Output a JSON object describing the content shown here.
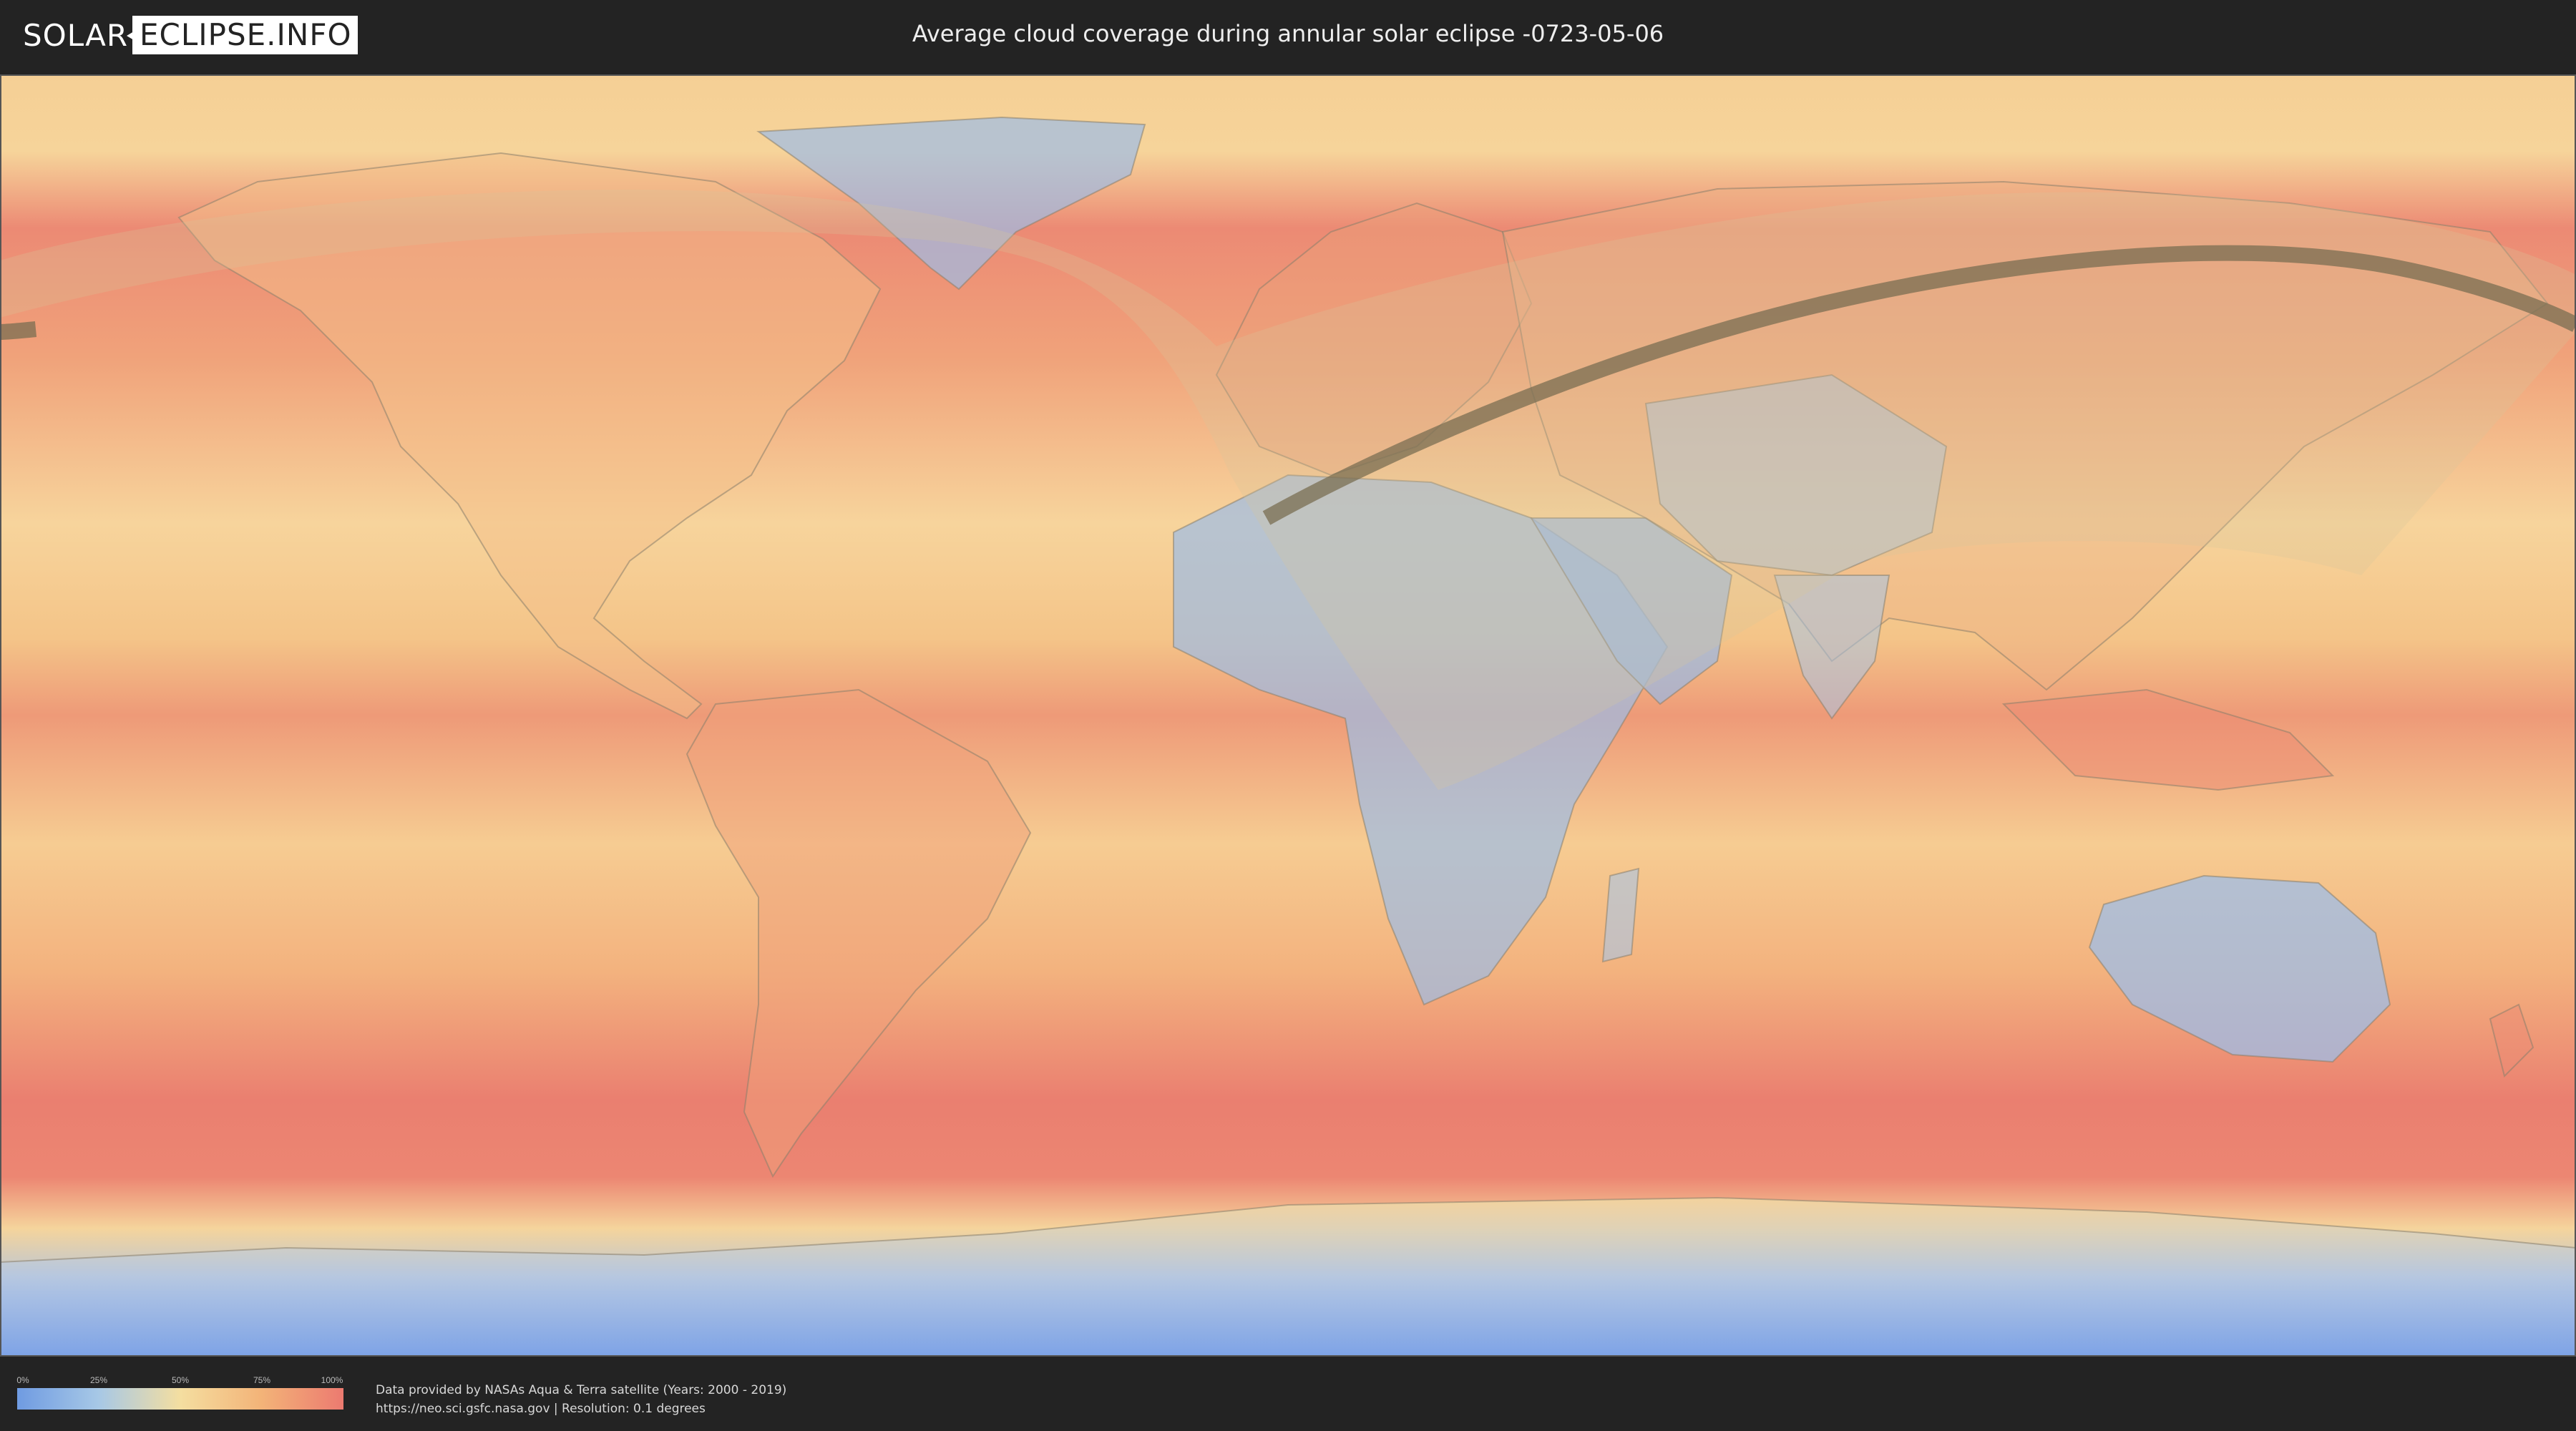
{
  "header": {
    "logo_part1": "SOLAR",
    "logo_part2": "ECLIPSE.INFO",
    "title": "Average cloud coverage during annular solar eclipse -0723-05-06"
  },
  "colors": {
    "background": "#232323",
    "cloud_low": "#6f9be2",
    "cloud_25": "#a7c8e6",
    "cloud_50": "#f4dea0",
    "cloud_75": "#f3b378",
    "cloud_high": "#ec7a70",
    "eclipse_path": "#7a6d52"
  },
  "legend": {
    "ticks": [
      "0%",
      "25%",
      "50%",
      "75%",
      "100%"
    ]
  },
  "credits": {
    "line1": "Data provided by NASAs Aqua & Terra satellite (Years: 2000 - 2019)",
    "line2": "https://neo.sci.gsfc.nasa.gov | Resolution: 0.1 degrees"
  }
}
